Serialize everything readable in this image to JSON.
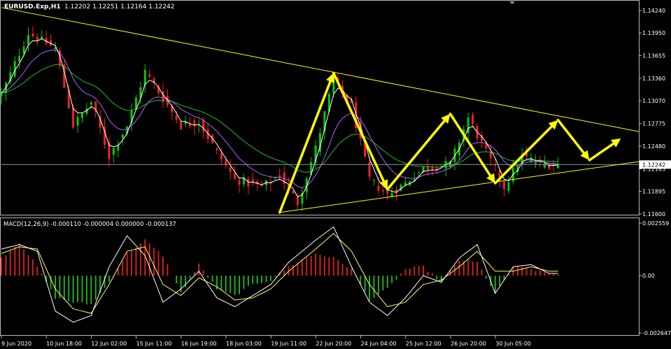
{
  "header": {
    "symbol_label": "EURUSD.Exp,H1",
    "ohlc_label": "1.12202 1.12251 1.12164 1.12242"
  },
  "price_axis": {
    "ticks": [
      "1.14240",
      "1.13950",
      "1.13655",
      "1.13360",
      "1.13070",
      "1.12775",
      "1.12480",
      "1.12185",
      "1.11895",
      "1.11600"
    ],
    "current_price": "1.12242"
  },
  "macd": {
    "label": "MACD(12,26,9) -0.000110 -0.000004 0.000000 -0.000137",
    "ticks": [
      "0.002559",
      "0.00",
      "-0.002647"
    ]
  },
  "time_axis": {
    "ticks": [
      "9 Jun 2020",
      "10 Jun 18:00",
      "12 Jun 02:00",
      "15 Jun 11:00",
      "16 Jun 19:00",
      "18 Jun 03:00",
      "19 Jun 11:00",
      "22 Jun 20:00",
      "24 Jun 04:00",
      "25 Jun 12:00",
      "26 Jun 20:00",
      "30 Jun 05:00"
    ]
  },
  "colors": {
    "background": "#000000",
    "axis_text": "#ffffff",
    "bull_candle": "#00cc00",
    "bear_candle": "#ff2020",
    "trendline": "#ffff00",
    "forecast_arrows": "#ffff00",
    "ma_fast": "#ffffff",
    "ma_medium": "#aa66ff",
    "ma_slow": "#22bb22",
    "macd_positive": "#cc2222",
    "macd_negative": "#22aa22",
    "macd_line": "#ffffff",
    "signal_line": "#ffff66",
    "grid": "#4a4a4a"
  },
  "chart_data": {
    "type": "candlestick",
    "symbol": "EURUSD.Exp",
    "timeframe": "H1",
    "y_range": [
      1.116,
      1.1436
    ],
    "close_path": [
      [
        0,
        1.1315
      ],
      [
        6,
        1.1395
      ],
      [
        12,
        1.1375
      ],
      [
        16,
        1.1275
      ],
      [
        20,
        1.1305
      ],
      [
        24,
        1.1235
      ],
      [
        28,
        1.1275
      ],
      [
        32,
        1.1345
      ],
      [
        36,
        1.131
      ],
      [
        40,
        1.1275
      ],
      [
        44,
        1.128
      ],
      [
        48,
        1.124
      ],
      [
        52,
        1.1205
      ],
      [
        58,
        1.1195
      ],
      [
        62,
        1.121
      ],
      [
        66,
        1.1175
      ],
      [
        70,
        1.1245
      ],
      [
        74,
        1.1335
      ],
      [
        78,
        1.13
      ],
      [
        82,
        1.1205
      ],
      [
        86,
        1.1185
      ],
      [
        90,
        1.12
      ],
      [
        94,
        1.122
      ],
      [
        100,
        1.1225
      ],
      [
        104,
        1.1285
      ],
      [
        108,
        1.124
      ],
      [
        112,
        1.1195
      ],
      [
        116,
        1.1235
      ],
      [
        120,
        1.1225
      ],
      [
        124,
        1.1224
      ]
    ],
    "trendlines": [
      {
        "from": [
          0,
          1.1428
        ],
        "to": [
          142,
          1.1267
        ]
      },
      {
        "from": [
          62,
          1.1162
        ],
        "to": [
          142,
          1.1228
        ]
      }
    ],
    "forecast_zigzag": [
      [
        62,
        1.1162
      ],
      [
        74,
        1.1343
      ],
      [
        86,
        1.1192
      ],
      [
        100,
        1.129
      ],
      [
        110,
        1.12
      ],
      [
        124,
        1.1282
      ],
      [
        131,
        1.123
      ],
      [
        138,
        1.1258
      ]
    ],
    "macd": {
      "params": "12,26,9",
      "range": [
        -0.002647,
        0.002559
      ],
      "histogram": [
        [
          0,
          0.0008
        ],
        [
          4,
          0.0015
        ],
        [
          8,
          0.0004
        ],
        [
          12,
          -0.001
        ],
        [
          16,
          -0.0012
        ],
        [
          20,
          -0.0013
        ],
        [
          24,
          -0.0003
        ],
        [
          28,
          0.001
        ],
        [
          32,
          0.0016
        ],
        [
          36,
          0.0009
        ],
        [
          40,
          -0.0008
        ],
        [
          44,
          0.0005
        ],
        [
          48,
          -0.0006
        ],
        [
          52,
          -0.0009
        ],
        [
          56,
          -0.0004
        ],
        [
          60,
          -0.0002
        ],
        [
          64,
          0.0004
        ],
        [
          70,
          0.001
        ],
        [
          74,
          0.0008
        ],
        [
          78,
          0.0003
        ],
        [
          82,
          -0.0011
        ],
        [
          86,
          -0.0006
        ],
        [
          90,
          0.0003
        ],
        [
          94,
          0.0004
        ],
        [
          98,
          -0.0003
        ],
        [
          102,
          0.0007
        ],
        [
          106,
          0.0006
        ],
        [
          110,
          -0.0008
        ],
        [
          114,
          0.0004
        ],
        [
          118,
          0.0003
        ],
        [
          122,
          0.0001
        ]
      ],
      "main_line": [
        [
          0,
          0.0012
        ],
        [
          4,
          0.0014
        ],
        [
          8,
          0.0011
        ],
        [
          12,
          -0.0016
        ],
        [
          16,
          -0.0021
        ],
        [
          20,
          -0.0018
        ],
        [
          24,
          0.0004
        ],
        [
          28,
          0.0018
        ],
        [
          32,
          0.0009
        ],
        [
          36,
          -0.0012
        ],
        [
          40,
          -0.0006
        ],
        [
          44,
          0.0002
        ],
        [
          48,
          -0.001
        ],
        [
          52,
          -0.0014
        ],
        [
          56,
          -0.0009
        ],
        [
          60,
          -0.0004
        ],
        [
          64,
          0.0006
        ],
        [
          70,
          0.0016
        ],
        [
          74,
          0.0022
        ],
        [
          78,
          0.0004
        ],
        [
          82,
          -0.0012
        ],
        [
          86,
          -0.0018
        ],
        [
          90,
          -0.001
        ],
        [
          94,
          0.0
        ],
        [
          98,
          -0.0003
        ],
        [
          102,
          0.0008
        ],
        [
          106,
          0.0014
        ],
        [
          110,
          -0.0008
        ],
        [
          114,
          0.0004
        ],
        [
          118,
          0.0005
        ],
        [
          122,
          0.0001
        ]
      ],
      "signal_line": [
        [
          0,
          0.001
        ],
        [
          4,
          0.0013
        ],
        [
          8,
          0.0012
        ],
        [
          12,
          -0.0006
        ],
        [
          16,
          -0.0015
        ],
        [
          20,
          -0.0017
        ],
        [
          24,
          -0.0004
        ],
        [
          28,
          0.0011
        ],
        [
          32,
          0.0013
        ],
        [
          36,
          -0.0004
        ],
        [
          40,
          -0.0009
        ],
        [
          44,
          -0.0001
        ],
        [
          48,
          -0.0005
        ],
        [
          52,
          -0.0011
        ],
        [
          56,
          -0.001
        ],
        [
          60,
          -0.0006
        ],
        [
          64,
          0.0002
        ],
        [
          70,
          0.0012
        ],
        [
          74,
          0.0019
        ],
        [
          78,
          0.0011
        ],
        [
          82,
          -0.0004
        ],
        [
          86,
          -0.0014
        ],
        [
          90,
          -0.0012
        ],
        [
          94,
          -0.0004
        ],
        [
          98,
          -0.0002
        ],
        [
          102,
          0.0004
        ],
        [
          106,
          0.0011
        ],
        [
          110,
          0.0002
        ],
        [
          114,
          0.0002
        ],
        [
          118,
          0.0004
        ],
        [
          122,
          0.0002
        ]
      ]
    }
  }
}
